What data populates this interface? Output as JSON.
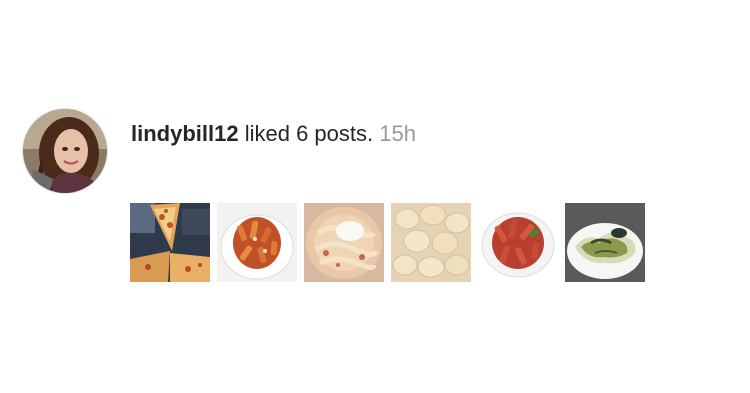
{
  "notification": {
    "username": "lindybill12",
    "action": "liked 6 posts.",
    "timestamp": "15h"
  },
  "avatar": {
    "icon": "user-profile-photo"
  },
  "posts": [
    {
      "icon": "pizza-photo"
    },
    {
      "icon": "rigatoni-pasta-photo"
    },
    {
      "icon": "creamy-pasta-photo"
    },
    {
      "icon": "tortellini-photo"
    },
    {
      "icon": "penne-pasta-photo"
    },
    {
      "icon": "ravioli-pesto-photo"
    }
  ]
}
